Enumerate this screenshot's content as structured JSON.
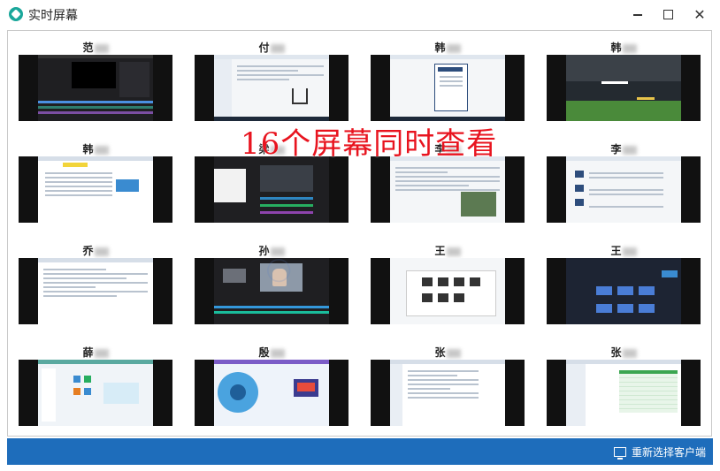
{
  "window": {
    "title": "实时屏幕"
  },
  "overlay_caption": "16个屏幕同时查看",
  "footer": {
    "reselect_label": "重新选择客户端"
  },
  "colors": {
    "footer": "#1e6dbb",
    "caption": "#e8141f",
    "app_icon": "#1aa79b"
  },
  "clients": [
    {
      "name": "范"
    },
    {
      "name": "付"
    },
    {
      "name": "韩"
    },
    {
      "name": "韩"
    },
    {
      "name": "韩"
    },
    {
      "name": "梁"
    },
    {
      "name": "李"
    },
    {
      "name": "李"
    },
    {
      "name": "乔"
    },
    {
      "name": "孙"
    },
    {
      "name": "王"
    },
    {
      "name": "王"
    },
    {
      "name": "薛"
    },
    {
      "name": "殷"
    },
    {
      "name": "张"
    },
    {
      "name": "张"
    }
  ]
}
